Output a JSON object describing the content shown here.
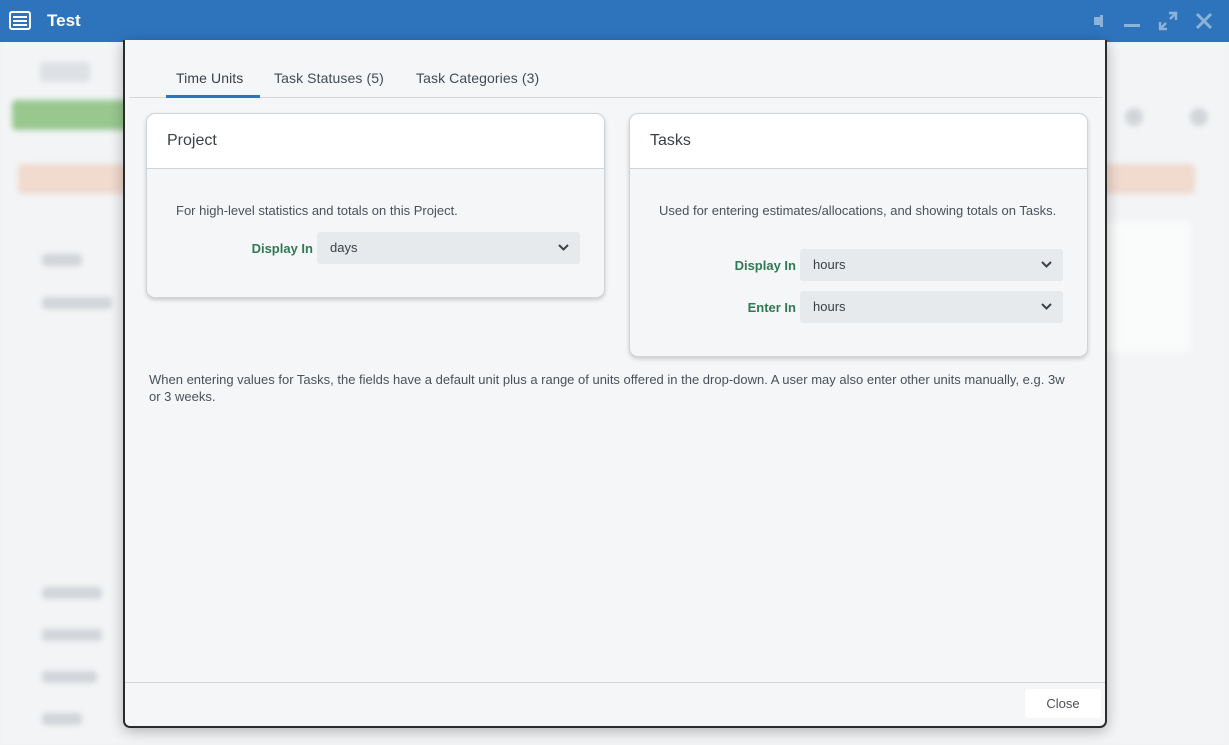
{
  "window": {
    "title": "Test",
    "icon": "list-window-icon",
    "controls": [
      "pin-icon",
      "minimize-icon",
      "maximize-icon",
      "close-icon"
    ]
  },
  "dialog": {
    "tabs": [
      {
        "label": "Time Units",
        "active": true
      },
      {
        "label": "Task Statuses (5)",
        "active": false
      },
      {
        "label": "Task Categories (3)",
        "active": false
      }
    ],
    "project_card": {
      "title": "Project",
      "description": "For high-level statistics and totals on this Project.",
      "display_in_label": "Display In",
      "display_in_value": "days"
    },
    "tasks_card": {
      "title": "Tasks",
      "description": "Used for entering estimates/allocations, and showing totals on Tasks.",
      "display_in_label": "Display In",
      "display_in_value": "hours",
      "enter_in_label": "Enter In",
      "enter_in_value": "hours"
    },
    "note": "When entering values for Tasks, the fields have a default unit plus a range of units offered in the drop-down. A user may also enter other units manually, e.g. 3w or 3 weeks.",
    "close_label": "Close"
  },
  "colors": {
    "titlebar": "#2e74bd",
    "tab_underline": "#2e74bd",
    "field_label": "#2f7a52",
    "modal_bg": "#f4f6f8"
  }
}
